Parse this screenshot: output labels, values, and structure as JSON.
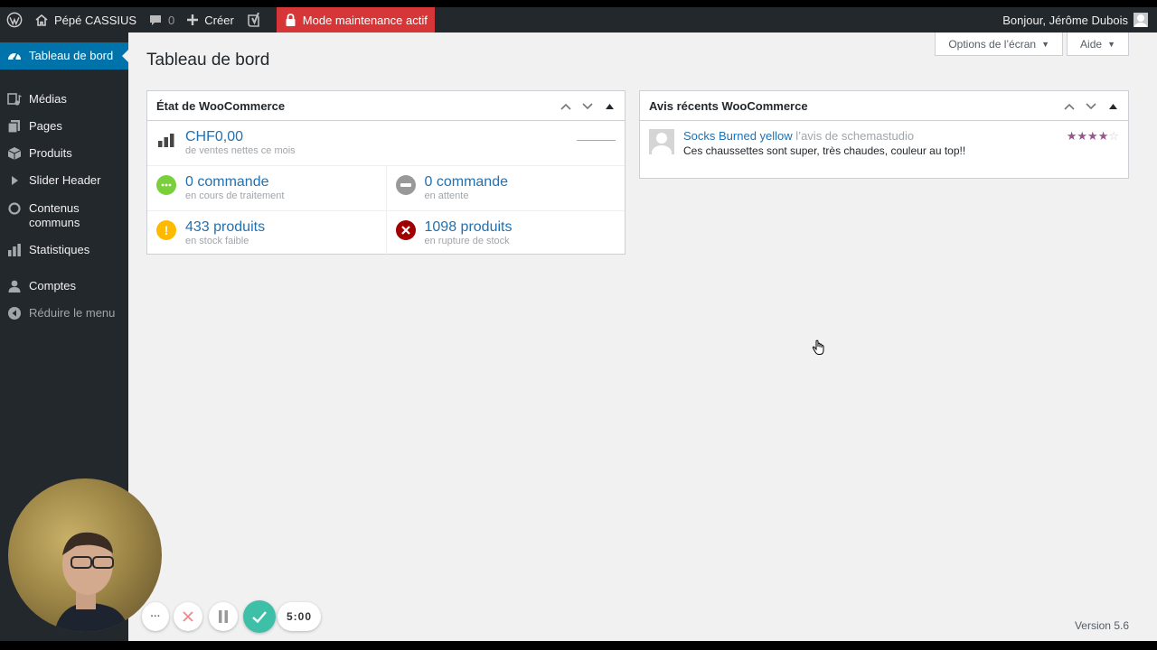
{
  "adminbar": {
    "site_name": "Pépé CASSIUS",
    "comments_count": "0",
    "new_label": "Créer",
    "maintenance_label": "Mode maintenance actif",
    "greeting": "Bonjour, Jérôme Dubois"
  },
  "sidebar": {
    "items": [
      {
        "label": "Tableau de bord",
        "icon": "dashboard-icon"
      },
      {
        "label": "Médias",
        "icon": "media-icon"
      },
      {
        "label": "Pages",
        "icon": "pages-icon"
      },
      {
        "label": "Produits",
        "icon": "products-icon"
      },
      {
        "label": "Slider Header",
        "icon": "slider-icon"
      },
      {
        "label": "Contenus communs",
        "icon": "circle-icon"
      },
      {
        "label": "Statistiques",
        "icon": "stats-icon"
      },
      {
        "label": "Comptes",
        "icon": "users-icon"
      },
      {
        "label": "Réduire le menu",
        "icon": "collapse-icon"
      }
    ]
  },
  "screen_options": {
    "label": "Options de l’écran"
  },
  "help": {
    "label": "Aide"
  },
  "page_title": "Tableau de bord",
  "woo_status": {
    "title": "État de WooCommerce",
    "sales": {
      "amount": "CHF0,00",
      "caption": "de ventes nettes ce mois"
    },
    "processing": {
      "value": "0 commande",
      "caption": "en cours de traitement",
      "color": "#7ad03a"
    },
    "on_hold": {
      "value": "0 commande",
      "caption": "en attente",
      "color": "#999999"
    },
    "low_stock": {
      "value": "433 produits",
      "caption": "en stock faible",
      "color": "#ffba00"
    },
    "out_of_stock": {
      "value": "1098 produits",
      "caption": "en rupture de stock",
      "color": "#a00000"
    }
  },
  "reviews": {
    "title": "Avis récents WooCommerce",
    "items": [
      {
        "product": "Socks Burned yellow",
        "author_text": "l’avis de schemastudio",
        "text": "Ces chaussettes sont super, très chaudes, couleur au top!!",
        "rating": 4,
        "max_rating": 5
      }
    ]
  },
  "footer": {
    "version": "Version 5.6"
  },
  "recorder": {
    "time": "5:00"
  },
  "colors": {
    "accent": "#0073aa",
    "link": "#2271b1",
    "maintenance": "#d63638",
    "admin_dark": "#23282d",
    "star": "#96588a",
    "recorder_check": "#3ebfa8"
  }
}
